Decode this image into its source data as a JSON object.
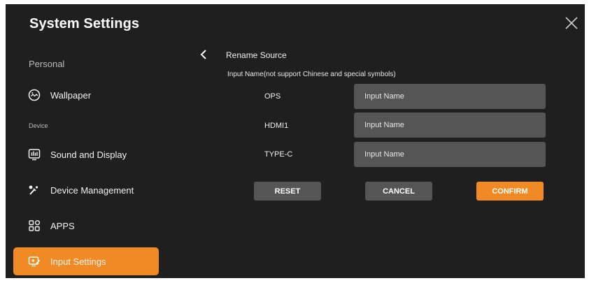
{
  "header": {
    "title": "System Settings",
    "close_icon": "close-x-icon"
  },
  "sidebar": {
    "sections": [
      {
        "label": "Personal"
      },
      {
        "label": "Device"
      }
    ],
    "items": [
      {
        "label": "Wallpaper",
        "icon": "wallpaper-icon",
        "active": false
      },
      {
        "label": "Sound and Display",
        "icon": "sound-display-icon",
        "active": false
      },
      {
        "label": "Device Management",
        "icon": "device-management-icon",
        "active": false
      },
      {
        "label": "APPS",
        "icon": "apps-grid-icon",
        "active": false
      },
      {
        "label": "Input Settings",
        "icon": "input-settings-icon",
        "active": true
      }
    ]
  },
  "panel": {
    "back_icon": "chevron-left-icon",
    "title": "Rename Source",
    "hint": "Input Name(not support Chinese and special symbols)",
    "sources": [
      {
        "label": "OPS",
        "value": "",
        "placeholder": "Input Name"
      },
      {
        "label": "HDMI1",
        "value": "",
        "placeholder": "Input Name"
      },
      {
        "label": "TYPE-C",
        "value": "",
        "placeholder": "Input Name"
      }
    ],
    "buttons": {
      "reset": "RESET",
      "cancel": "CANCEL",
      "confirm": "CONFIRM"
    }
  },
  "colors": {
    "background": "#1f1f1f",
    "accent": "#f08a24",
    "field": "#555555",
    "text": "#ffffff"
  }
}
